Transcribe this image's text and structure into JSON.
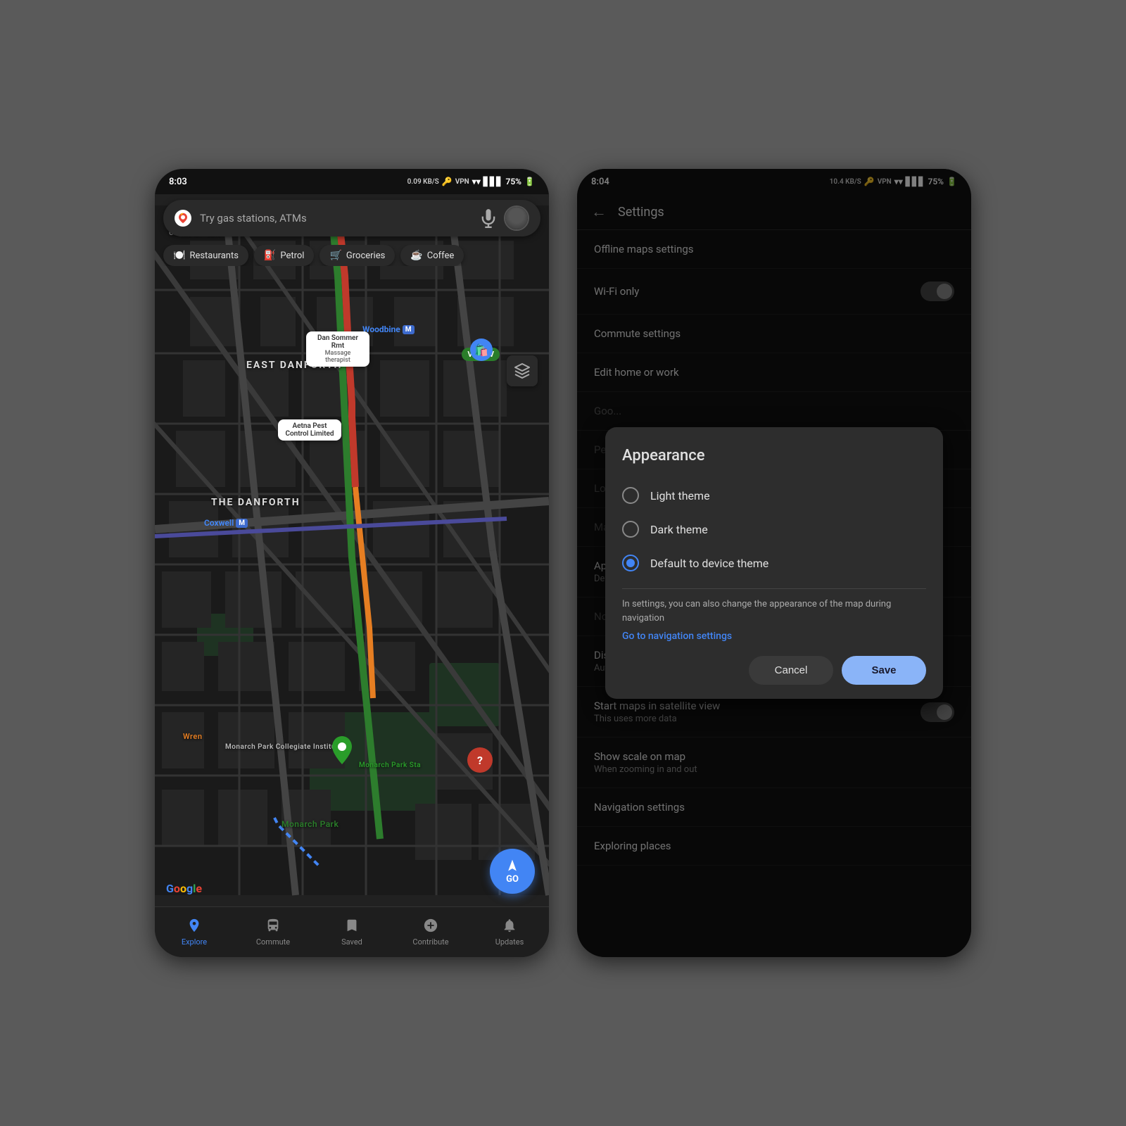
{
  "left_phone": {
    "status_bar": {
      "time": "8:03",
      "speed": "0.09 KB/S",
      "battery": "75%"
    },
    "search": {
      "placeholder": "Try gas stations, ATMs"
    },
    "categories": [
      {
        "icon": "🍽️",
        "label": "Restaurants"
      },
      {
        "icon": "⛽",
        "label": "Petrol"
      },
      {
        "icon": "🛒",
        "label": "Groceries"
      },
      {
        "icon": "☕",
        "label": "Coffee"
      }
    ],
    "map_labels": [
      {
        "text": "EAST DANFORTH",
        "type": "large"
      },
      {
        "text": "THE DANFORTH",
        "type": "large"
      },
      {
        "text": "Woodbine",
        "type": "metro"
      },
      {
        "text": "Coxwell",
        "type": "metro"
      },
      {
        "text": "Dan Sommer Rmt",
        "type": "poi_subtitle",
        "sub": "Massage therapist"
      },
      {
        "text": "Aetna Pest Control Limited",
        "type": "poi"
      },
      {
        "text": "Monarch Park Collegiate Institute",
        "type": "poi"
      },
      {
        "text": "Monarch Park Sta",
        "type": "poi"
      },
      {
        "text": "Monarch Park",
        "type": "park"
      },
      {
        "text": "Wren",
        "type": "street"
      },
      {
        "text": "Google",
        "type": "watermark"
      }
    ],
    "go_button": "GO",
    "bottom_nav": [
      {
        "icon": "📍",
        "label": "Explore",
        "active": true
      },
      {
        "icon": "🚌",
        "label": "Commute",
        "active": false
      },
      {
        "icon": "🔖",
        "label": "Saved",
        "active": false
      },
      {
        "icon": "➕",
        "label": "Contribute",
        "active": false
      },
      {
        "icon": "🔔",
        "label": "Updates",
        "active": false
      }
    ]
  },
  "right_phone": {
    "status_bar": {
      "time": "8:04",
      "speed": "10.4 KB/S",
      "battery": "75%"
    },
    "header": {
      "back_label": "←",
      "title": "Settings"
    },
    "settings_items": [
      {
        "label": "Offline maps settings",
        "type": "nav"
      },
      {
        "label": "Wi-Fi only",
        "type": "toggle",
        "value": false
      },
      {
        "label": "Commute settings",
        "type": "nav"
      },
      {
        "label": "Edit home or work",
        "type": "nav"
      },
      {
        "label": "Goo...",
        "type": "nav"
      },
      {
        "label": "Per...",
        "type": "nav"
      },
      {
        "label": "Loc...",
        "type": "nav"
      },
      {
        "label": "Ma...",
        "type": "nav"
      },
      {
        "label": "App...",
        "sublabel": "Defa...",
        "type": "nav_active"
      },
      {
        "label": "Not...",
        "type": "nav"
      },
      {
        "label": "Dist...",
        "sublabel": "Automatic",
        "type": "nav"
      },
      {
        "label": "Start maps in satellite view",
        "sublabel": "This uses more data",
        "type": "toggle",
        "value": false
      },
      {
        "label": "Show scale on map",
        "sublabel": "When zooming in and out",
        "type": "nav"
      },
      {
        "label": "Navigation settings",
        "type": "nav"
      },
      {
        "label": "Exploring places",
        "type": "nav"
      }
    ],
    "appearance_modal": {
      "title": "Appearance",
      "options": [
        {
          "label": "Light theme",
          "selected": false
        },
        {
          "label": "Dark theme",
          "selected": false
        },
        {
          "label": "Default to device theme",
          "selected": true
        }
      ],
      "note": "In settings, you can also change the appearance of the map during navigation",
      "nav_link": "Go to navigation settings",
      "cancel_label": "Cancel",
      "save_label": "Save"
    }
  }
}
